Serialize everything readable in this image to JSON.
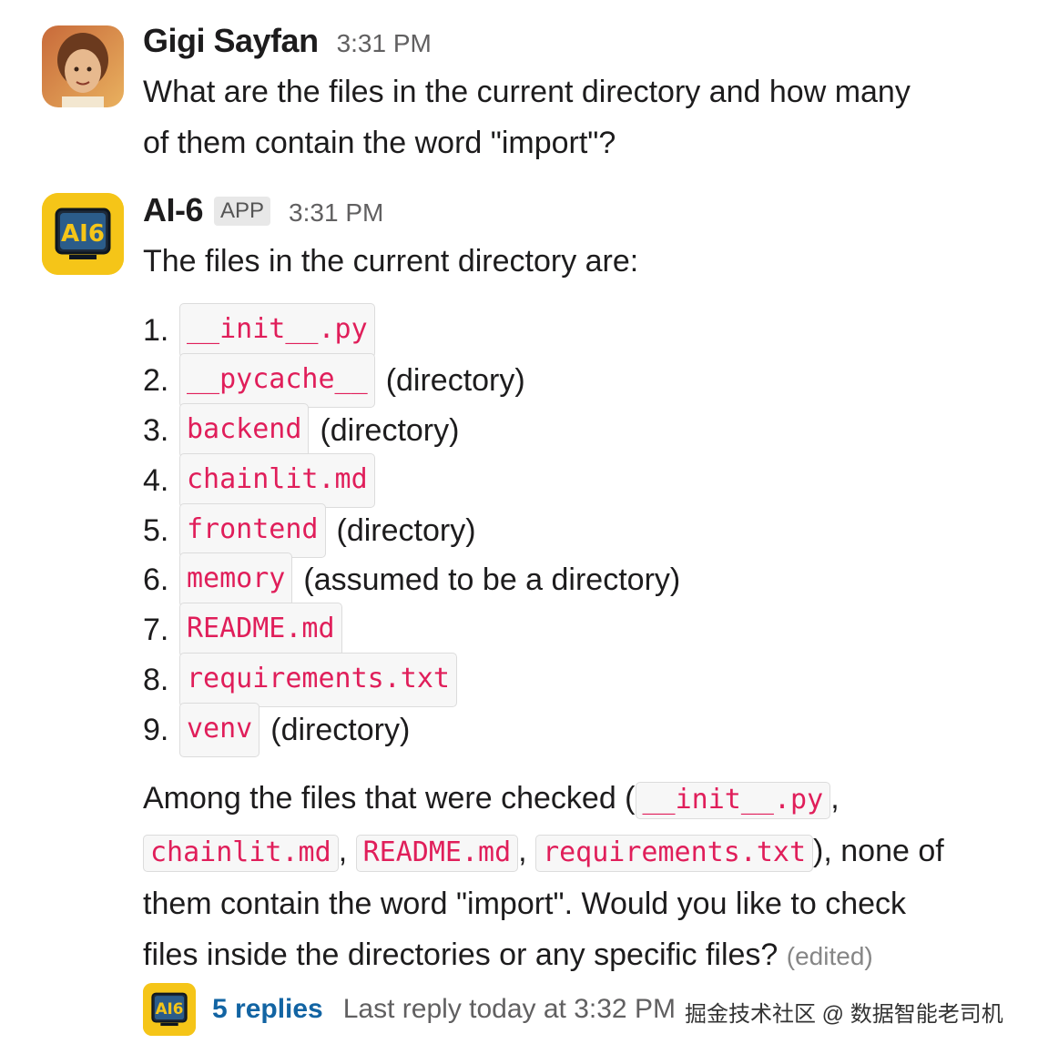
{
  "messages": [
    {
      "author": "Gigi Sayfan",
      "time": "3:31 PM",
      "lines": [
        "What are the files in the current directory and how many",
        "of them contain the word \"import\"?"
      ]
    },
    {
      "author": "AI-6",
      "badge": "APP",
      "time": "3:31 PM",
      "intro": "The files in the current directory are:",
      "files": [
        {
          "num": "1.",
          "name": "__init__.py",
          "note": ""
        },
        {
          "num": "2.",
          "name": "__pycache__",
          "note": "(directory)"
        },
        {
          "num": "3.",
          "name": "backend",
          "note": "(directory)"
        },
        {
          "num": "4.",
          "name": "chainlit.md",
          "note": ""
        },
        {
          "num": "5.",
          "name": "frontend",
          "note": "(directory)"
        },
        {
          "num": "6.",
          "name": "memory",
          "note": "(assumed to be a directory)"
        },
        {
          "num": "7.",
          "name": "README.md",
          "note": ""
        },
        {
          "num": "8.",
          "name": "requirements.txt",
          "note": ""
        },
        {
          "num": "9.",
          "name": "venv",
          "note": "(directory)"
        }
      ],
      "summary": {
        "prefix": "Among the files that were checked (",
        "checked": [
          "__init__.py",
          "chainlit.md",
          "README.md",
          "requirements.txt"
        ],
        "sep": ",",
        "after_checked": "), none of",
        "line3": "them contain the word \"import\". Would you like to check",
        "line4": "files inside the directories or any specific files?",
        "edited": "(edited)"
      },
      "thread": {
        "replies": "5 replies",
        "last_reply": "Last reply today at 3:32 PM"
      }
    }
  ],
  "watermark": "掘金技术社区 @ 数据智能老司机",
  "colors": {
    "code_text": "#e01e5a",
    "link": "#1264a3",
    "app_icon_bg": "#f5c518"
  }
}
